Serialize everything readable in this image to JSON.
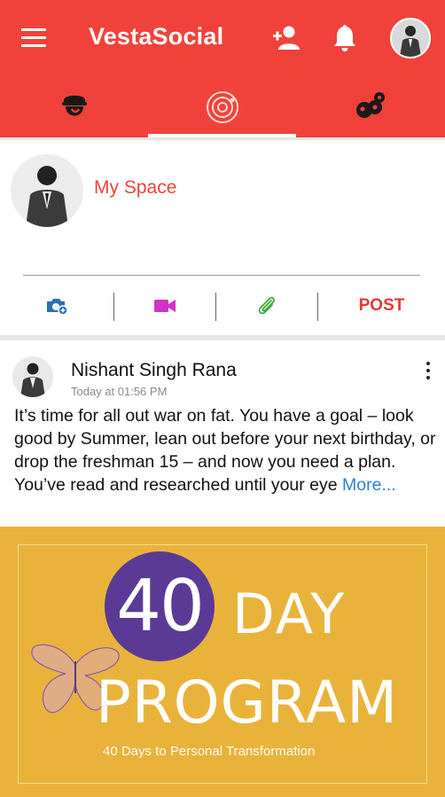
{
  "app": {
    "title": "VestaSocial",
    "brand_color": "#f0423a"
  },
  "header": {
    "icons": [
      "menu-icon",
      "add-friend-icon",
      "notification-bell-icon",
      "profile-avatar"
    ]
  },
  "tabs": [
    {
      "name": "profile-tab",
      "icon": "user-helmet-icon",
      "active": false
    },
    {
      "name": "orbit-tab",
      "icon": "orbit-target-icon",
      "active": true
    },
    {
      "name": "community-tab",
      "icon": "people-network-icon",
      "active": false
    }
  ],
  "space": {
    "title": "My Space",
    "actions": {
      "photo_icon": "camera-plus-icon",
      "video_icon": "video-camera-icon",
      "attach_icon": "paperclip-icon",
      "post_label": "POST"
    }
  },
  "post": {
    "author": "Nishant Singh Rana",
    "time": "Today at 01:56 PM",
    "text": "It’s time for all out war on fat. You have a goal – look good by Summer, lean out before your next birthday, or drop the freshman 15 – and now you need a plan. You’ve read and researched until your eye ",
    "more": "More...",
    "image": {
      "number": "40",
      "day": "DAY",
      "program": "PROGRAM",
      "subtitle": "40 Days to Personal Transformation",
      "bg_color": "#e9b33b",
      "circle_color": "#5b3a96"
    }
  }
}
